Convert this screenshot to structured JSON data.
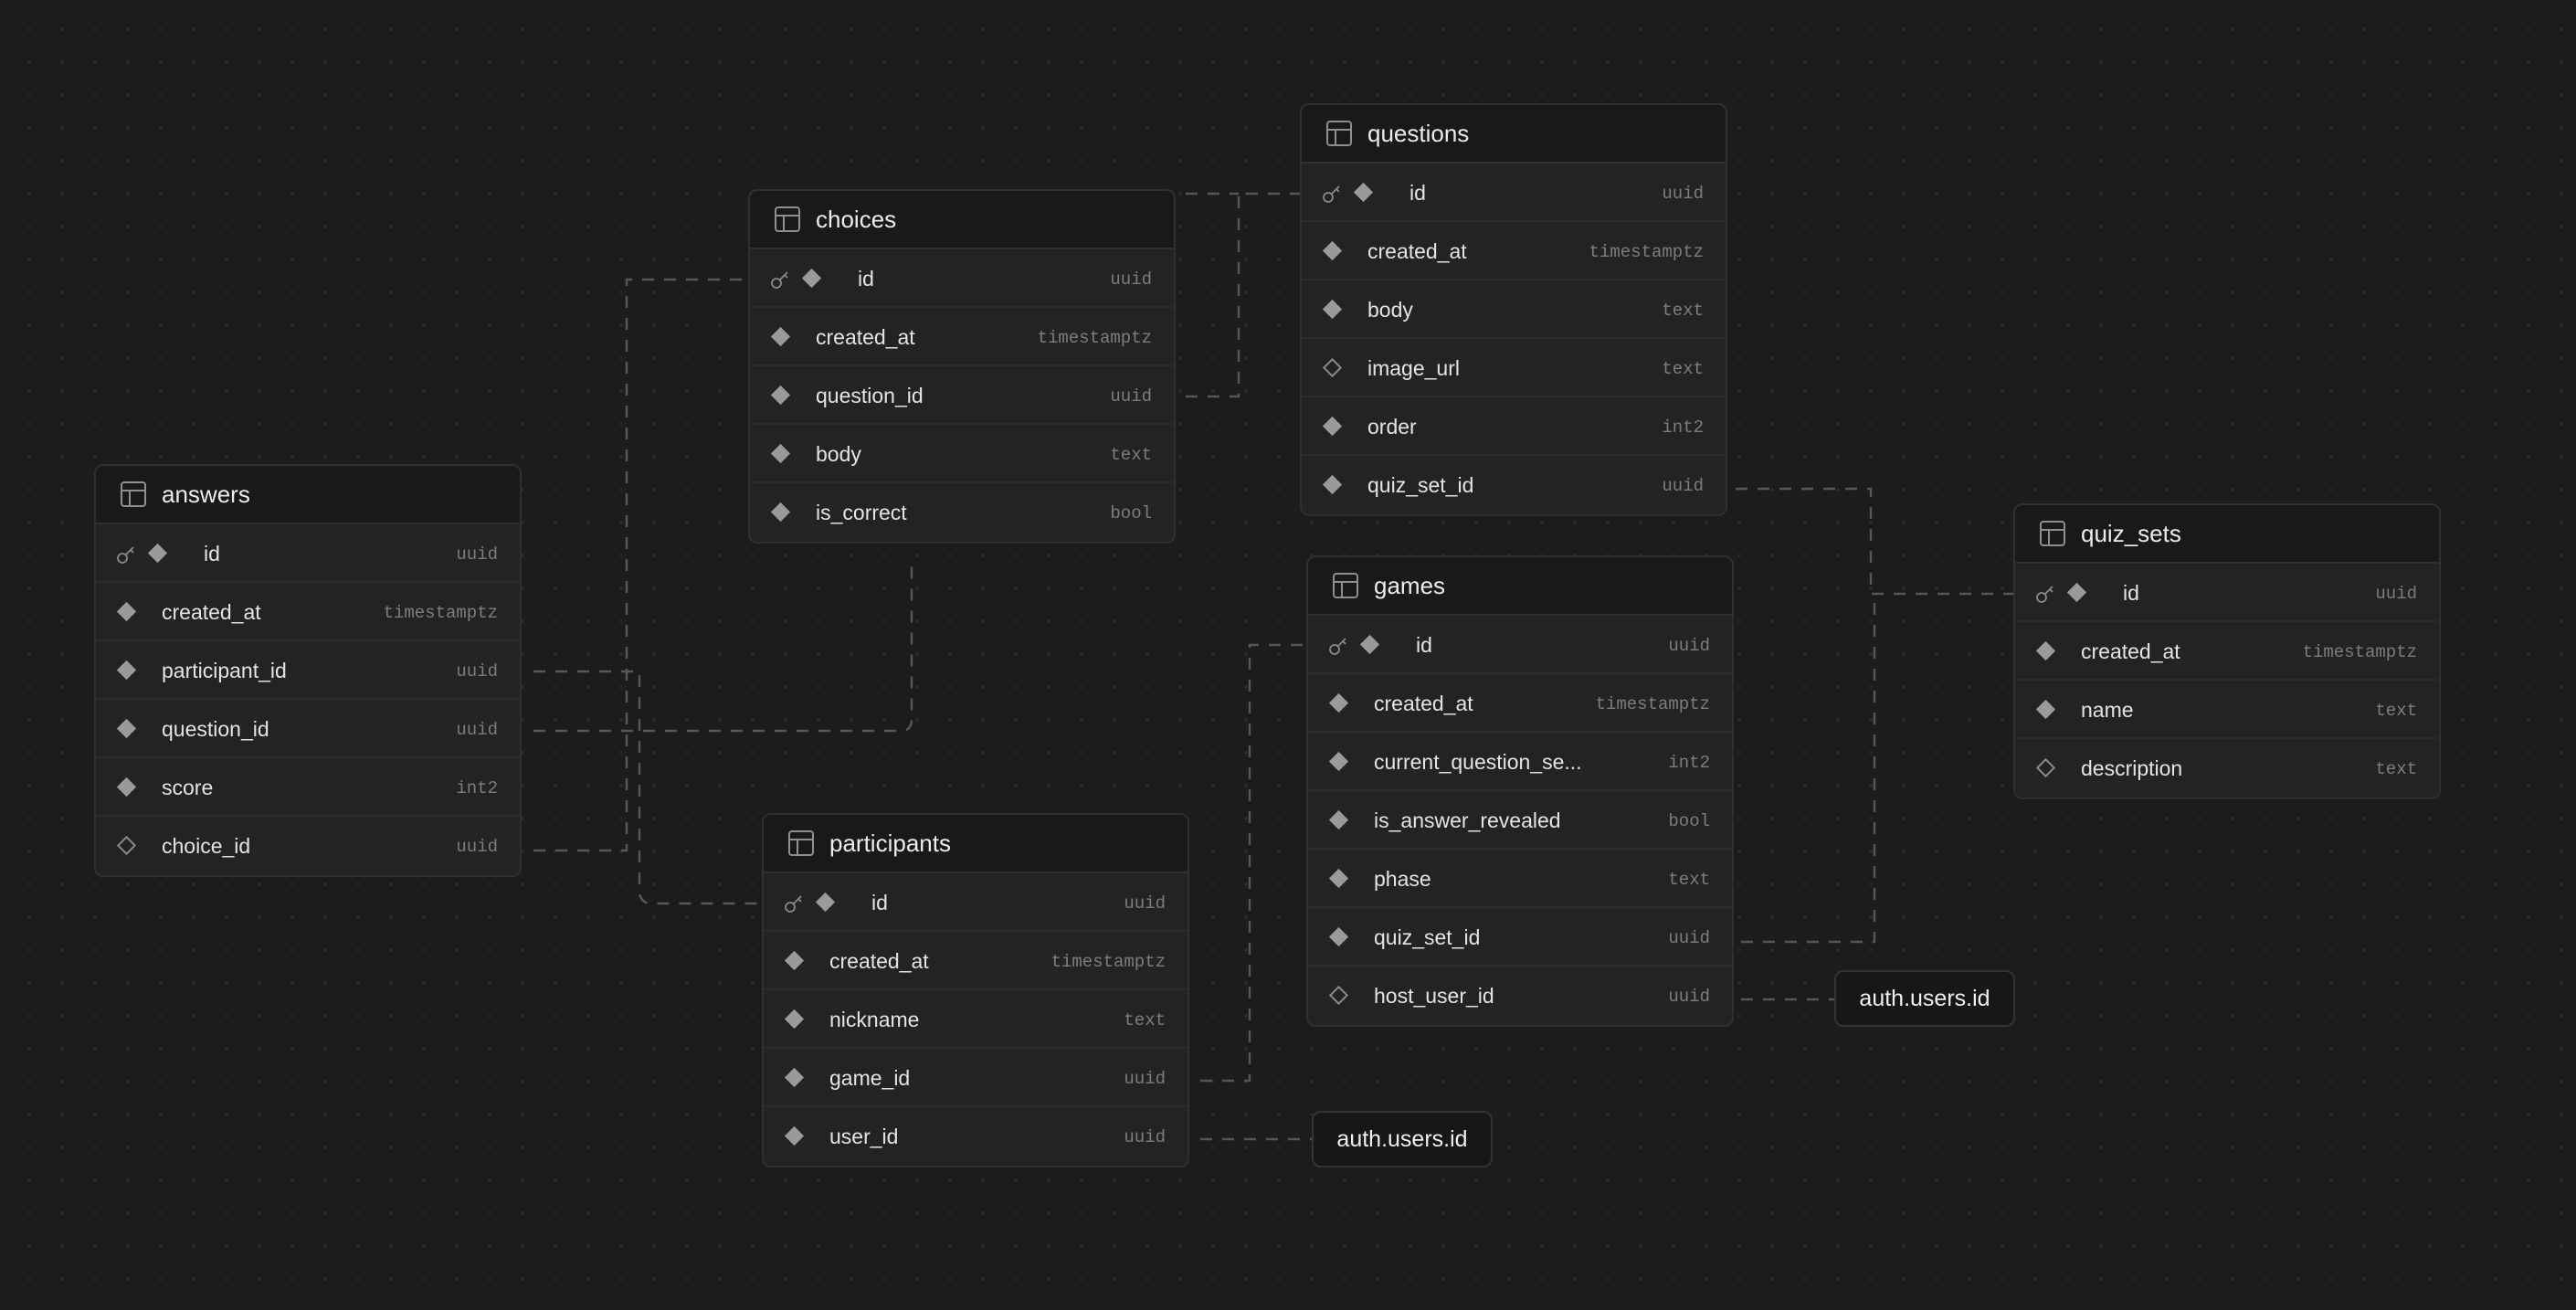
{
  "tables": [
    {
      "id": "questions",
      "name": "questions",
      "columns": [
        {
          "name": "id",
          "type": "uuid",
          "pk": true,
          "nullable": false
        },
        {
          "name": "created_at",
          "type": "timestamptz",
          "pk": false,
          "nullable": false
        },
        {
          "name": "body",
          "type": "text",
          "pk": false,
          "nullable": false
        },
        {
          "name": "image_url",
          "type": "text",
          "pk": false,
          "nullable": true
        },
        {
          "name": "order",
          "type": "int2",
          "pk": false,
          "nullable": false
        },
        {
          "name": "quiz_set_id",
          "type": "uuid",
          "pk": false,
          "nullable": false
        }
      ]
    },
    {
      "id": "choices",
      "name": "choices",
      "columns": [
        {
          "name": "id",
          "type": "uuid",
          "pk": true,
          "nullable": false
        },
        {
          "name": "created_at",
          "type": "timestamptz",
          "pk": false,
          "nullable": false
        },
        {
          "name": "question_id",
          "type": "uuid",
          "pk": false,
          "nullable": false
        },
        {
          "name": "body",
          "type": "text",
          "pk": false,
          "nullable": false
        },
        {
          "name": "is_correct",
          "type": "bool",
          "pk": false,
          "nullable": false
        }
      ]
    },
    {
      "id": "answers",
      "name": "answers",
      "columns": [
        {
          "name": "id",
          "type": "uuid",
          "pk": true,
          "nullable": false
        },
        {
          "name": "created_at",
          "type": "timestamptz",
          "pk": false,
          "nullable": false
        },
        {
          "name": "participant_id",
          "type": "uuid",
          "pk": false,
          "nullable": false
        },
        {
          "name": "question_id",
          "type": "uuid",
          "pk": false,
          "nullable": false
        },
        {
          "name": "score",
          "type": "int2",
          "pk": false,
          "nullable": false
        },
        {
          "name": "choice_id",
          "type": "uuid",
          "pk": false,
          "nullable": true
        }
      ]
    },
    {
      "id": "games",
      "name": "games",
      "columns": [
        {
          "name": "id",
          "type": "uuid",
          "pk": true,
          "nullable": false
        },
        {
          "name": "created_at",
          "type": "timestamptz",
          "pk": false,
          "nullable": false
        },
        {
          "name": "current_question_se...",
          "type": "int2",
          "pk": false,
          "nullable": false
        },
        {
          "name": "is_answer_revealed",
          "type": "bool",
          "pk": false,
          "nullable": false
        },
        {
          "name": "phase",
          "type": "text",
          "pk": false,
          "nullable": false
        },
        {
          "name": "quiz_set_id",
          "type": "uuid",
          "pk": false,
          "nullable": false
        },
        {
          "name": "host_user_id",
          "type": "uuid",
          "pk": false,
          "nullable": true
        }
      ]
    },
    {
      "id": "participants",
      "name": "participants",
      "columns": [
        {
          "name": "id",
          "type": "uuid",
          "pk": true,
          "nullable": false
        },
        {
          "name": "created_at",
          "type": "timestamptz",
          "pk": false,
          "nullable": false
        },
        {
          "name": "nickname",
          "type": "text",
          "pk": false,
          "nullable": false
        },
        {
          "name": "game_id",
          "type": "uuid",
          "pk": false,
          "nullable": false
        },
        {
          "name": "user_id",
          "type": "uuid",
          "pk": false,
          "nullable": false
        }
      ]
    },
    {
      "id": "quiz_sets",
      "name": "quiz_sets",
      "columns": [
        {
          "name": "id",
          "type": "uuid",
          "pk": true,
          "nullable": false
        },
        {
          "name": "created_at",
          "type": "timestamptz",
          "pk": false,
          "nullable": false
        },
        {
          "name": "name",
          "type": "text",
          "pk": false,
          "nullable": false
        },
        {
          "name": "description",
          "type": "text",
          "pk": false,
          "nullable": true
        }
      ]
    }
  ],
  "refs": [
    {
      "id": "auth-ref-games",
      "label": "auth.users.id"
    },
    {
      "id": "auth-ref-participants",
      "label": "auth.users.id"
    }
  ],
  "colors": {
    "background": "#1c1c1c",
    "table_body": "#232323",
    "table_header": "#191919",
    "line": "#575757"
  }
}
